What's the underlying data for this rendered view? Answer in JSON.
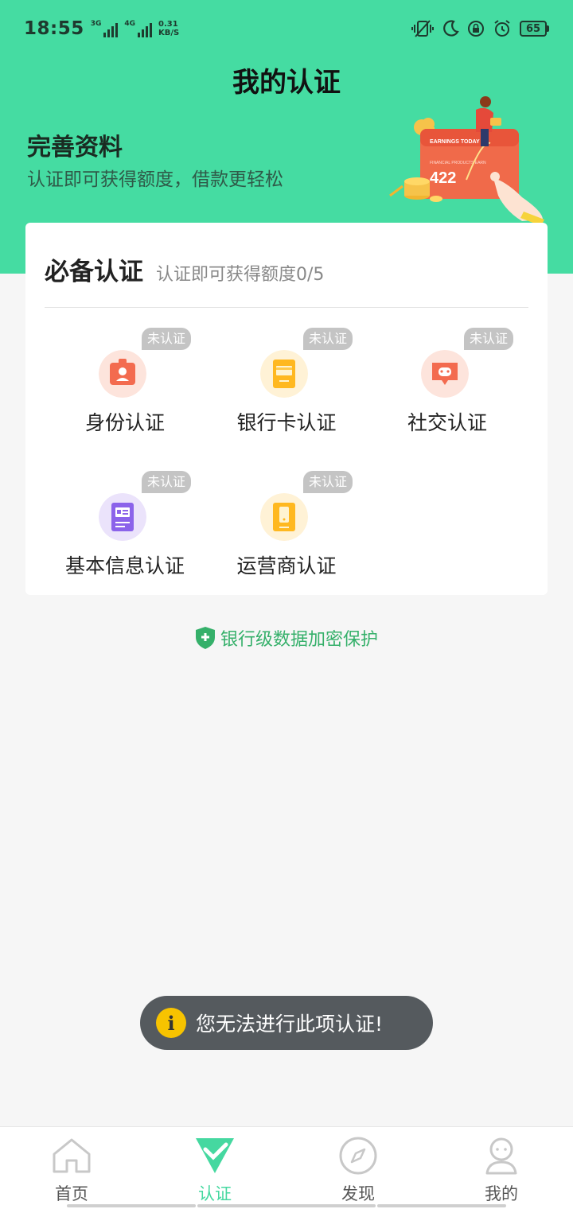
{
  "status": {
    "time": "18:55",
    "sim1": "3G",
    "sim2": "4G",
    "speed_value": "0.31",
    "speed_unit": "KB/S",
    "battery": "65"
  },
  "page_title": "我的认证",
  "profile": {
    "title": "完善资料",
    "subtitle": "认证即可获得额度，借款更轻松"
  },
  "hero_card": {
    "header": "EARNINGS TODAY",
    "small_text": "FINANCIAL PRODUCTS EARN",
    "amount": "422"
  },
  "required": {
    "title": "必备认证",
    "subtitle": "认证即可获得额度0/5",
    "badge": "未认证",
    "items": [
      {
        "label": "身份认证",
        "icon": "id-badge-icon",
        "color": "#f36b4f"
      },
      {
        "label": "银行卡认证",
        "icon": "bank-card-icon",
        "color": "#ffb820"
      },
      {
        "label": "社交认证",
        "icon": "chat-icon",
        "color": "#f36b4f"
      },
      {
        "label": "基本信息认证",
        "icon": "info-form-icon",
        "color": "#8b63ea"
      },
      {
        "label": "运营商认证",
        "icon": "phone-icon",
        "color": "#ffb820"
      }
    ]
  },
  "secure_text": "银行级数据加密保护",
  "toast": "您无法进行此项认证!",
  "tabs": [
    {
      "label": "首页",
      "icon": "home-icon"
    },
    {
      "label": "认证",
      "icon": "verify-check-icon"
    },
    {
      "label": "发现",
      "icon": "compass-icon"
    },
    {
      "label": "我的",
      "icon": "profile-icon"
    }
  ],
  "colors": {
    "brand": "#45dca2",
    "secure": "#35b06a",
    "toast_icon": "#f7c300"
  }
}
